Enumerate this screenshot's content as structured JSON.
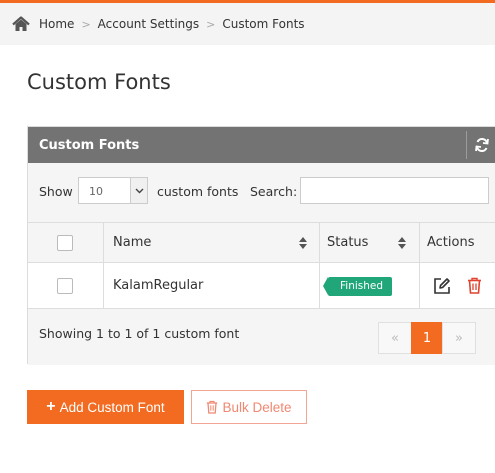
{
  "colors": {
    "accent": "#f26b21",
    "panel_header": "#737373",
    "status_finished": "#21a67a",
    "delete_red": "#e0432f"
  },
  "breadcrumb": {
    "home_icon": "home-icon",
    "items": [
      "Home",
      "Account Settings",
      "Custom Fonts"
    ],
    "separator": ">"
  },
  "page": {
    "title": "Custom Fonts"
  },
  "panel": {
    "title": "Custom Fonts",
    "refresh_icon": "refresh-icon"
  },
  "controls": {
    "show_label": "Show",
    "page_size": "10",
    "page_size_suffix": "custom fonts",
    "search_label": "Search:",
    "search_value": ""
  },
  "table": {
    "columns": [
      "Name",
      "Status",
      "Actions"
    ],
    "rows": [
      {
        "name": "KalamRegular",
        "status": "Finished",
        "actions": [
          "edit-icon",
          "trash-icon"
        ]
      }
    ]
  },
  "footer": {
    "info": "Showing 1 to 1 of 1 custom fonts",
    "pagination": {
      "prev": "«",
      "current": "1",
      "next": "»"
    }
  },
  "buttons": {
    "add": "Add Custom Font",
    "add_icon": "+",
    "bulk_delete": "Bulk Delete"
  }
}
